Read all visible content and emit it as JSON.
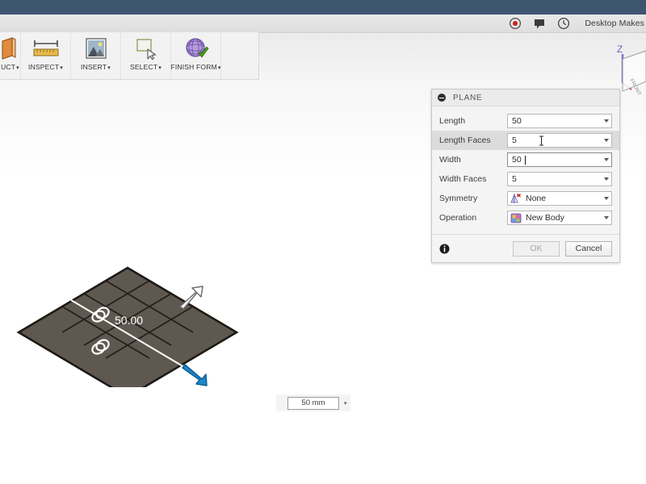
{
  "window": {
    "titlebar_color": "#3e5570"
  },
  "header": {
    "account_name": "Desktop Makes",
    "icons": [
      {
        "name": "record-icon",
        "label": "Record"
      },
      {
        "name": "comment-icon",
        "label": "Comments"
      },
      {
        "name": "history-clock-icon",
        "label": "Job Status"
      }
    ]
  },
  "ribbon": {
    "items": [
      {
        "label": "UCT",
        "caret": "▾",
        "icon": "construct-plane-icon",
        "truncated": true
      },
      {
        "label": "INSPECT",
        "caret": "▾",
        "icon": "inspect-ruler-icon"
      },
      {
        "label": "INSERT",
        "caret": "▾",
        "icon": "insert-image-icon"
      },
      {
        "label": "SELECT",
        "caret": "▾",
        "icon": "select-cursor-icon"
      },
      {
        "label": "FINISH FORM",
        "caret": "▾",
        "icon": "finish-form-icon"
      }
    ]
  },
  "viewport": {
    "viewcube": {
      "axis_label": "Z",
      "face_label": "FRONT"
    },
    "model": {
      "type": "plane",
      "grid_rows": 5,
      "grid_cols": 5,
      "dimension_label": "50.00",
      "handles": [
        {
          "name": "grid-handle-upper"
        },
        {
          "name": "grid-handle-lower"
        }
      ],
      "arrows": [
        {
          "name": "length-arrow-white",
          "color": "#ffffff",
          "direction": "up-right"
        },
        {
          "name": "width-arrow-blue",
          "color": "#1b87cd",
          "direction": "down-right"
        }
      ],
      "fill_color": "#5f5850",
      "edge_color": "#1d1a16"
    },
    "dimension_input": {
      "value": "50 mm",
      "dropdown_caret": "▾"
    }
  },
  "dialog": {
    "title": "PLANE",
    "collapse_icon": "collapse-minus-icon",
    "rows": [
      {
        "label": "Length",
        "value": "50",
        "name": "length",
        "state": "normal",
        "caret": false,
        "ibeam": false,
        "icon": null
      },
      {
        "label": "Length Faces",
        "value": "5",
        "name": "length-faces",
        "state": "hover",
        "caret": false,
        "ibeam": true,
        "icon": null
      },
      {
        "label": "Width",
        "value": "50",
        "name": "width",
        "state": "focused",
        "caret": true,
        "ibeam": false,
        "icon": null
      },
      {
        "label": "Width Faces",
        "value": "5",
        "name": "width-faces",
        "state": "normal",
        "caret": false,
        "ibeam": false,
        "icon": null
      },
      {
        "label": "Symmetry",
        "value": "None",
        "name": "symmetry",
        "state": "normal",
        "caret": false,
        "ibeam": false,
        "icon": "symmetry-none-icon"
      },
      {
        "label": "Operation",
        "value": "New Body",
        "name": "operation",
        "state": "normal",
        "caret": false,
        "ibeam": false,
        "icon": "new-body-icon"
      }
    ],
    "footer": {
      "info_icon": "info-icon",
      "ok_label": "OK",
      "cancel_label": "Cancel"
    }
  }
}
